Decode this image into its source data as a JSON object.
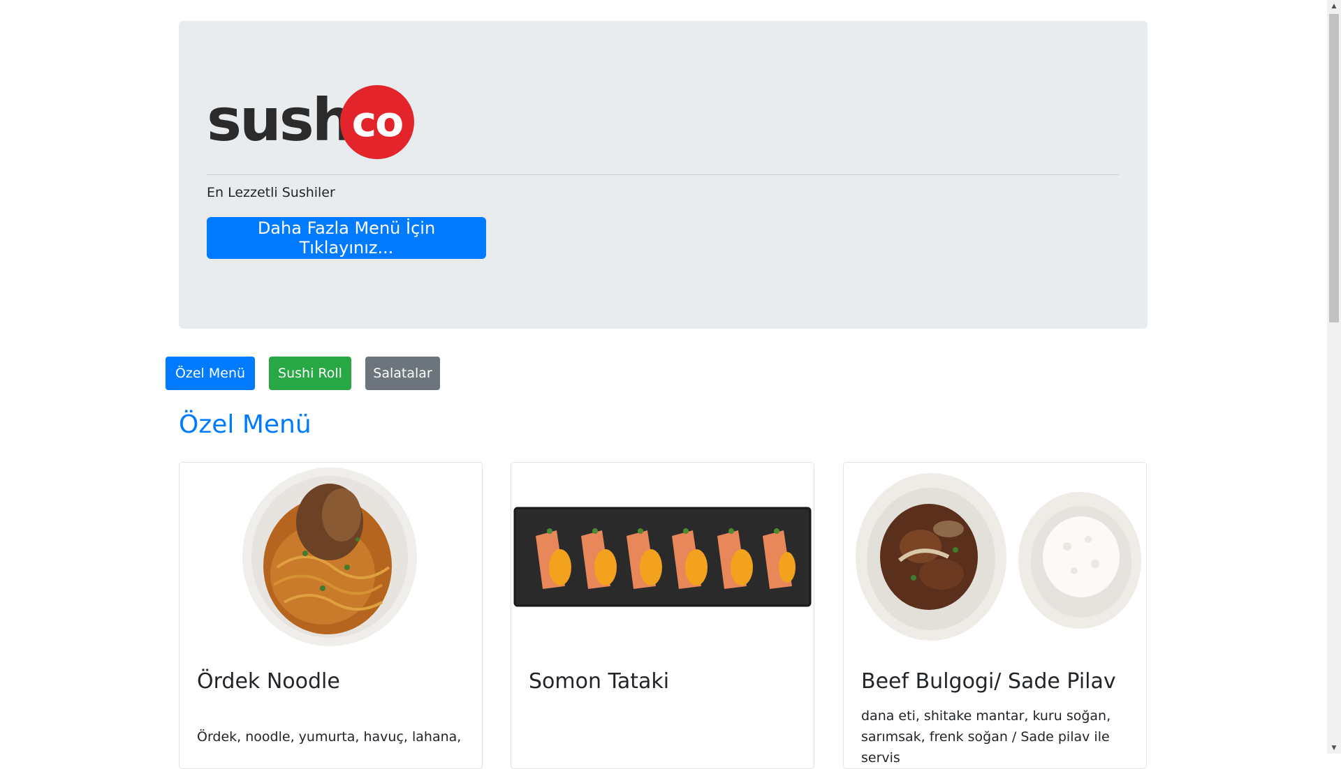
{
  "jumbotron": {
    "logo": {
      "word": "sushi",
      "circle_text": "co",
      "brand_color": "#e3242b"
    },
    "tagline": "En Lezzetli Sushiler",
    "cta_label": "Daha Fazla Menü İçin Tıklayınız..."
  },
  "tabs": [
    {
      "label": "Özel Menü",
      "color": "#007bff"
    },
    {
      "label": "Sushi Roll",
      "color": "#28a745"
    },
    {
      "label": "Salatalar",
      "color": "#6c757d"
    }
  ],
  "section": {
    "title": "Özel Menü"
  },
  "cards": [
    {
      "title": "Ördek Noodle",
      "text": "Ördek, noodle, yumurta, havuç, lahana,",
      "image": "duck-noodle-image"
    },
    {
      "title": "Somon Tataki",
      "text": "",
      "image": "salmon-tataki-image"
    },
    {
      "title": "Beef Bulgogi/ Sade Pilav",
      "text": "dana eti, shitake mantar, kuru soğan, sarımsak, frenk soğan / Sade pilav ile servis",
      "image": "beef-bulgogi-image"
    }
  ],
  "colors": {
    "primary": "#007bff",
    "success": "#28a745",
    "secondary": "#6c757d",
    "jumbotron_bg": "#e9ecef"
  }
}
